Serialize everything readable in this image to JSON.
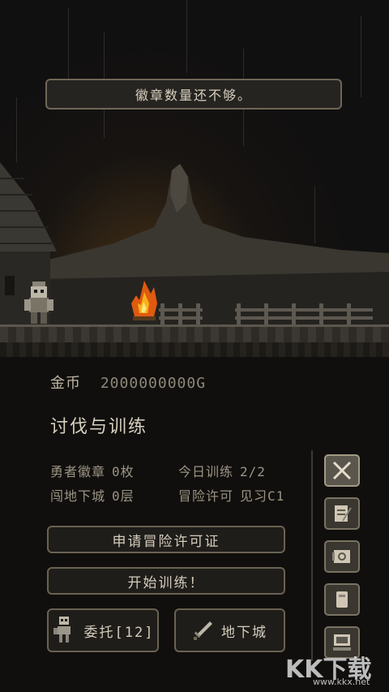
{
  "toast": {
    "message": "徽章数量还不够。"
  },
  "gold": {
    "label": "金币",
    "value": "2000000000G"
  },
  "section": {
    "title": "讨伐与训练"
  },
  "stats": {
    "badge_label": "勇者徽章",
    "badge_value": "0枚",
    "training_label": "今日训练",
    "training_value": "2/2",
    "dungeon_label": "闯地下城",
    "dungeon_value": "0层",
    "license_label": "冒险许可",
    "license_value": "见习C1"
  },
  "buttons": {
    "apply_license": "申请冒险许可证",
    "start_training": "开始训练！",
    "commission": "委托[12]",
    "dungeon": "地下城"
  },
  "side_menu": [
    "swords-icon",
    "scroll-icon",
    "map-icon",
    "tablet-icon",
    "computer-icon"
  ],
  "watermark": {
    "main": "KK下载",
    "sub": "www.kkx.net"
  }
}
